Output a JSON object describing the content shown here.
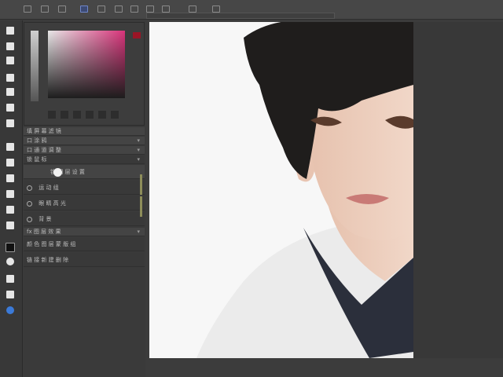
{
  "menubar": {
    "icons": [
      "file-menu-icon",
      "edit-menu-icon",
      "image-menu-icon",
      "layer-menu-icon",
      "select-menu-icon",
      "filter-menu-icon",
      "view-menu-icon",
      "window-menu-icon",
      "help-menu-icon",
      "extra-menu-icon",
      "extra2-menu-icon"
    ]
  },
  "tools": [
    "move-tool-icon",
    "marquee-tool-icon",
    "lasso-tool-icon",
    "crop-tool-icon",
    "eyedropper-tool-icon",
    "brush-tool-icon",
    "stamp-tool-icon",
    "eraser-tool-icon",
    "gradient-tool-icon",
    "pen-tool-icon",
    "type-tool-icon",
    "path-tool-icon",
    "shape-tool-icon",
    "hand-tool-icon",
    "zoom-tool-icon",
    "color-tool-icon"
  ],
  "colors": {
    "accent_pink": "#d9337a",
    "foreground": "#9a1526",
    "ui_bg": "#3b3b3b",
    "canvas": "#f7f7f7"
  },
  "layers_panel": {
    "rows": [
      {
        "label": "填 屏 幕 滤 镜",
        "kind": "header"
      },
      {
        "label": "口  涂 鸦",
        "kind": "row"
      },
      {
        "label": "口  通 道 调 整",
        "kind": "row"
      },
      {
        "label": "锁  鼠 标",
        "kind": "row"
      },
      {
        "label": "锁  图 层 设 置",
        "kind": "big"
      },
      {
        "label": "运 动 组",
        "kind": "big"
      },
      {
        "label": "眼 睛 高 光",
        "kind": "big"
      },
      {
        "label": "背 景",
        "kind": "big"
      },
      {
        "label": "fx  图 层 效 果",
        "kind": "row"
      },
      {
        "label": "颜 色  图 层  蒙 版  组",
        "kind": "big"
      },
      {
        "label": "链 接   新 建   删 除",
        "kind": "big"
      }
    ]
  }
}
